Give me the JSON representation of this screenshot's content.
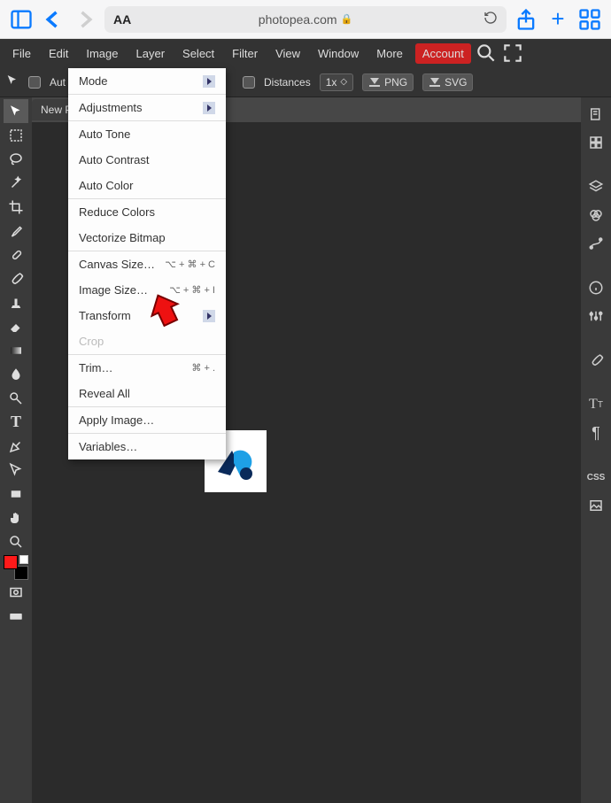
{
  "browser": {
    "url": "photopea.com",
    "lock_icon": "lock-icon",
    "text_size": "AA"
  },
  "menubar": {
    "items": [
      "File",
      "Edit",
      "Image",
      "Layer",
      "Select",
      "Filter",
      "View",
      "Window",
      "More"
    ],
    "account": "Account"
  },
  "options_bar": {
    "auto": "Aut",
    "distances": "Distances",
    "zoom": "1x",
    "png": "PNG",
    "svg": "SVG"
  },
  "tab": {
    "title": "New P"
  },
  "dropdown": {
    "mode": "Mode",
    "adjustments": "Adjustments",
    "auto_tone": "Auto Tone",
    "auto_contrast": "Auto Contrast",
    "auto_color": "Auto Color",
    "reduce_colors": "Reduce Colors",
    "vectorize": "Vectorize Bitmap",
    "canvas_size": "Canvas Size…",
    "canvas_size_sc": "⌥ + ⌘ + C",
    "image_size": "Image Size…",
    "image_size_sc": "⌥ + ⌘ + I",
    "transform": "Transform",
    "crop": "Crop",
    "trim": "Trim…",
    "trim_sc": "⌘ + .",
    "reveal_all": "Reveal All",
    "apply_image": "Apply Image…",
    "variables": "Variables…"
  },
  "right_panel": {
    "css": "CSS"
  }
}
